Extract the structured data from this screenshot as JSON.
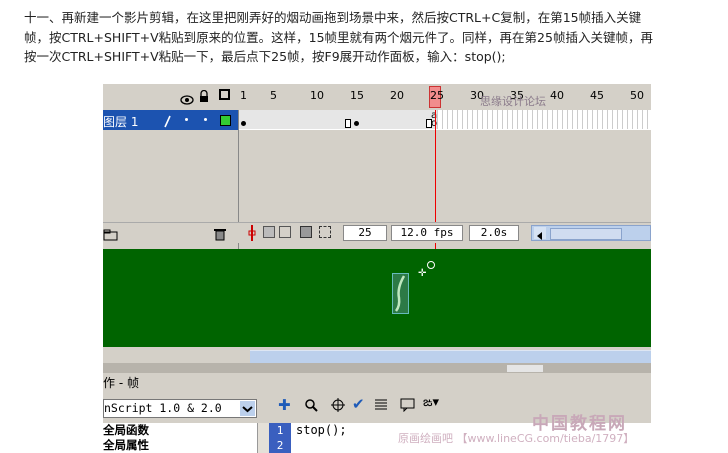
{
  "instructions": {
    "line1": "十一、再新建一个影片剪辑，在这里把刚弄好的烟动画拖到场景中来，然后按CTRL+C复制，在第15帧插入关键",
    "line2": "帧，按CTRL+SHIFT+V粘贴到原来的位置。这样，15帧里就有两个烟元件了。同样，再在第25帧插入关键帧，再",
    "line3": "按一次CTRL+SHIFT+V粘贴一下，最后点下25帧，按F9展开动作面板，输入：stop();"
  },
  "timeline": {
    "ruler_numbers": [
      "1",
      "5",
      "10",
      "15",
      "20",
      "25",
      "30",
      "35",
      "40",
      "45",
      "50"
    ],
    "current_frame_marker": "25",
    "layer_name": "图层 1",
    "status": {
      "frame": "25",
      "fps": "12.0 fps",
      "time": "2.0s"
    }
  },
  "actions_panel": {
    "title": "作 - 帧",
    "language_select": "nScript 1.0 & 2.0",
    "library_items": [
      "全局函数",
      "全局属性"
    ],
    "line_numbers": [
      "1",
      "2"
    ],
    "code": "stop();"
  },
  "watermarks": {
    "site1": "思缘设计论坛 www.MISSYUAN.COM",
    "site2": "中国教程网",
    "site3": "原画绘画吧 【www.lineCG.com/tieba/1797】"
  },
  "colors": {
    "layer_selected": "#1c53b0",
    "stage": "#006400",
    "playhead": "#e00000",
    "code_gutter": "#3a5fbf"
  }
}
